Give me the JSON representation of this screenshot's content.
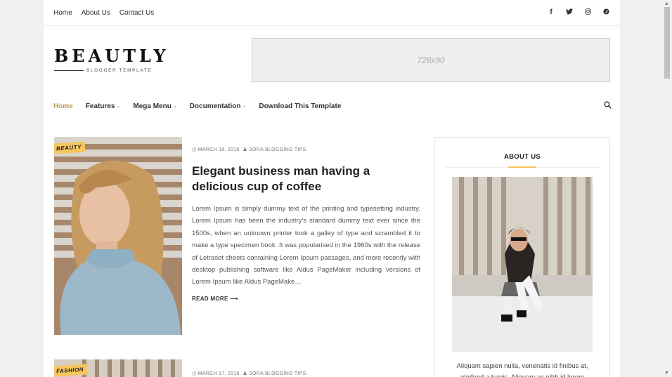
{
  "topbar": {
    "links": [
      "Home",
      "About Us",
      "Contact Us"
    ],
    "social": [
      "facebook-icon",
      "twitter-icon",
      "instagram-icon",
      "pinterest-icon"
    ]
  },
  "logo": {
    "name": "BEAUTLY",
    "tagline": "BLOGGER TEMPLATE"
  },
  "ad": {
    "label": "728x90"
  },
  "nav": {
    "home": "Home",
    "features": "Features",
    "mega": "Mega Menu",
    "docs": "Documentation",
    "download": "Download This Template"
  },
  "posts": [
    {
      "label": "BEAUTY",
      "date": "MARCH 18, 2016",
      "author": "SORA BLOGGING TIPS",
      "title": "Elegant business man having a delicious cup of coffee",
      "excerpt": "Lorem Ipsum is simply dummy text of the printing and typesetting industry. Lorem Ipsum has been the industry's standard dummy text ever since the 1500s, when an unknown printer took a galley of type and scrambled it to make a type specimen book .It was popularised in the 1960s with the release of Letraset sheets containing Lorem Ipsum passages, and more recently with desktop publishing software like Aldus PageMaker including versions of Lorem Ipsum like Aldus PageMake…",
      "read_more": "READ MORE"
    },
    {
      "label": "FASHION",
      "date": "MARCH 17, 2016",
      "author": "SORA BLOGGING TIPS"
    }
  ],
  "sidebar": {
    "title": "ABOUT US",
    "text": "Aliquam sapien nulla, venenatis id finibus at, eleifend a turpis. Aliquam ac nibh id lorem"
  },
  "colors": {
    "accent": "#c19c5b",
    "label": "#f7c65e"
  }
}
